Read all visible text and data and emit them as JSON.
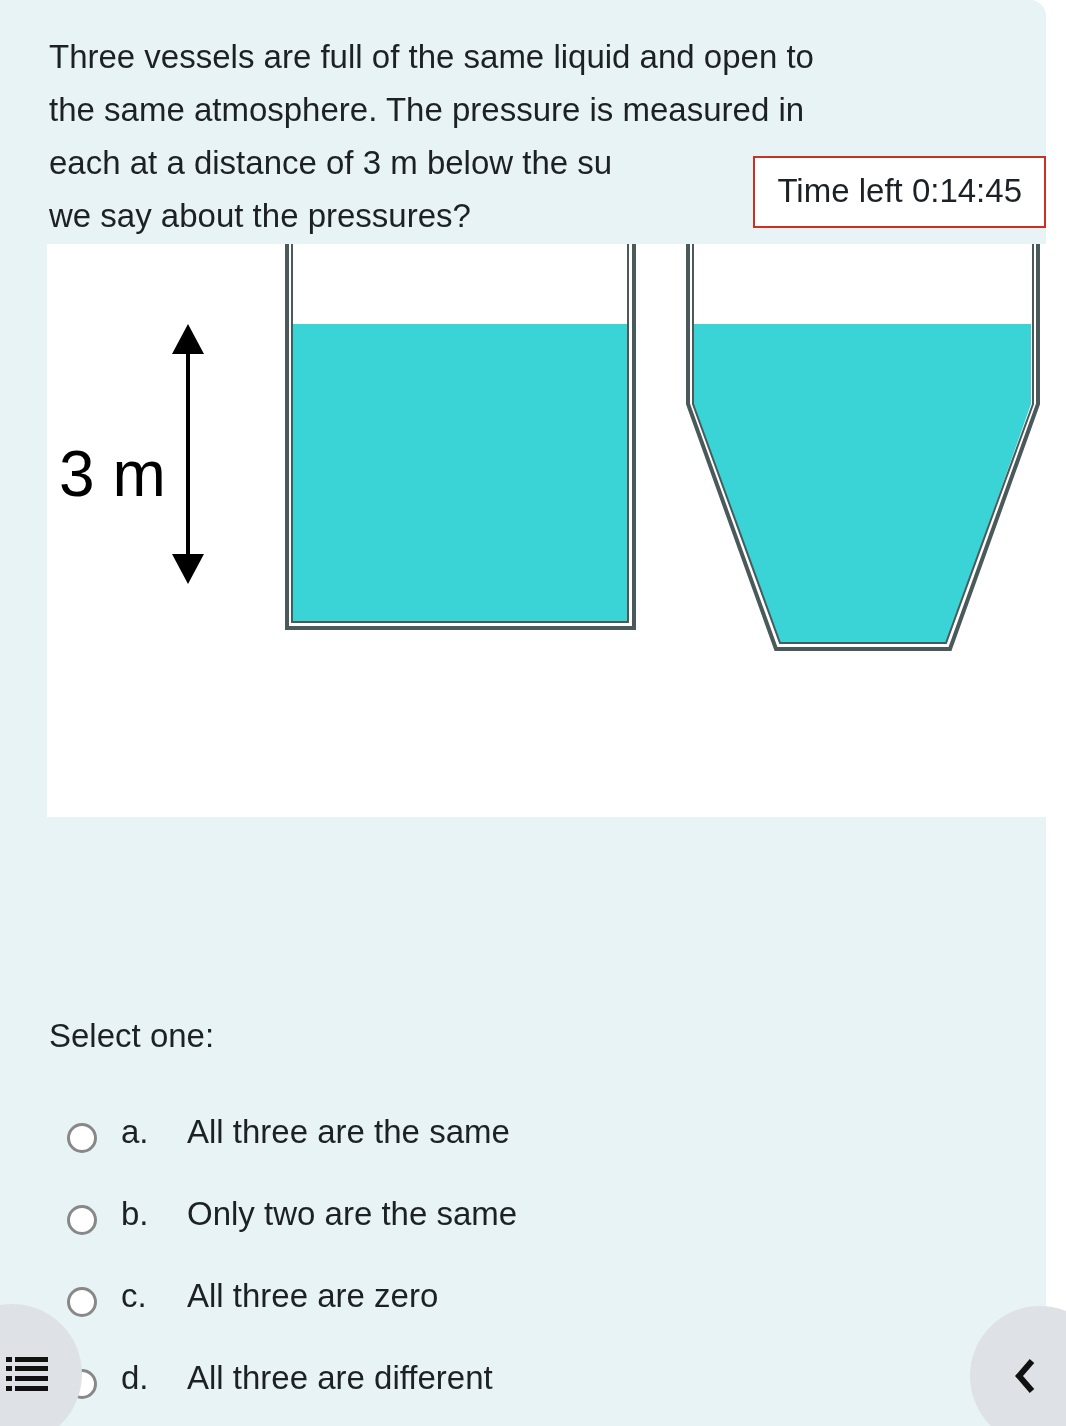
{
  "question": {
    "lines": [
      "Three vessels are full of the same liquid and open to",
      "the same atmosphere. The pressure is measured in",
      "each at a distance of 3 m below the su",
      "we say about the pressures?"
    ]
  },
  "timer": {
    "label": "Time left 0:14:45"
  },
  "figure": {
    "depth_label": "3 m"
  },
  "prompt": "Select one:",
  "options": [
    {
      "letter": "a.",
      "text": "All three are the same",
      "selected": false
    },
    {
      "letter": "b.",
      "text": "Only two are the same",
      "selected": false
    },
    {
      "letter": "c.",
      "text": "All three are zero",
      "selected": false
    },
    {
      "letter": "d.",
      "text": "All three are different",
      "selected": false
    }
  ]
}
